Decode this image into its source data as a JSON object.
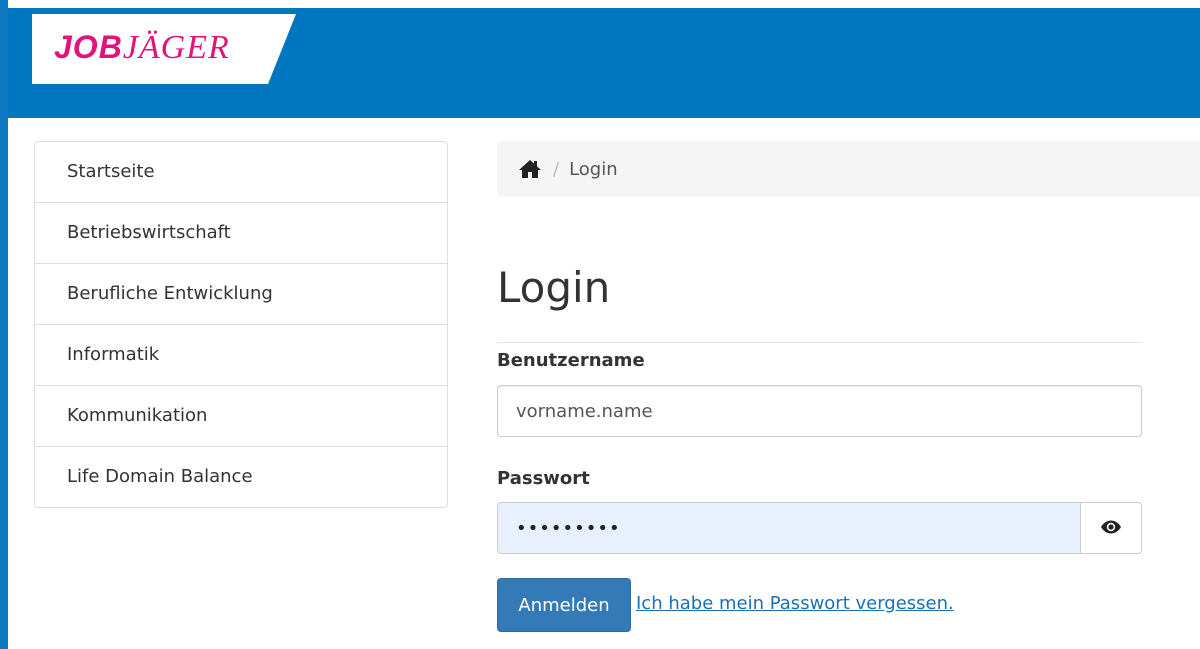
{
  "brand": {
    "logo_bold": "JOB",
    "logo_light": "JÄGER",
    "header_color": "#0176c0",
    "logo_color": "#e2137a"
  },
  "sidebar": {
    "items": [
      {
        "label": "Startseite"
      },
      {
        "label": "Betriebswirtschaft"
      },
      {
        "label": "Berufliche Entwicklung"
      },
      {
        "label": "Informatik"
      },
      {
        "label": "Kommunikation"
      },
      {
        "label": "Life Domain Balance"
      }
    ]
  },
  "breadcrumb": {
    "home_icon": "home-icon",
    "separator": "/",
    "current": "Login"
  },
  "main": {
    "title": "Login"
  },
  "form": {
    "username": {
      "label": "Benutzername",
      "value": "vorname.name"
    },
    "password": {
      "label": "Passwort",
      "value": "•••••••••",
      "toggle_icon": "eye-icon"
    },
    "submit_label": "Anmelden",
    "forgot_link": "Ich habe mein Passwort vergessen.",
    "accent_color": "#337ab7"
  }
}
